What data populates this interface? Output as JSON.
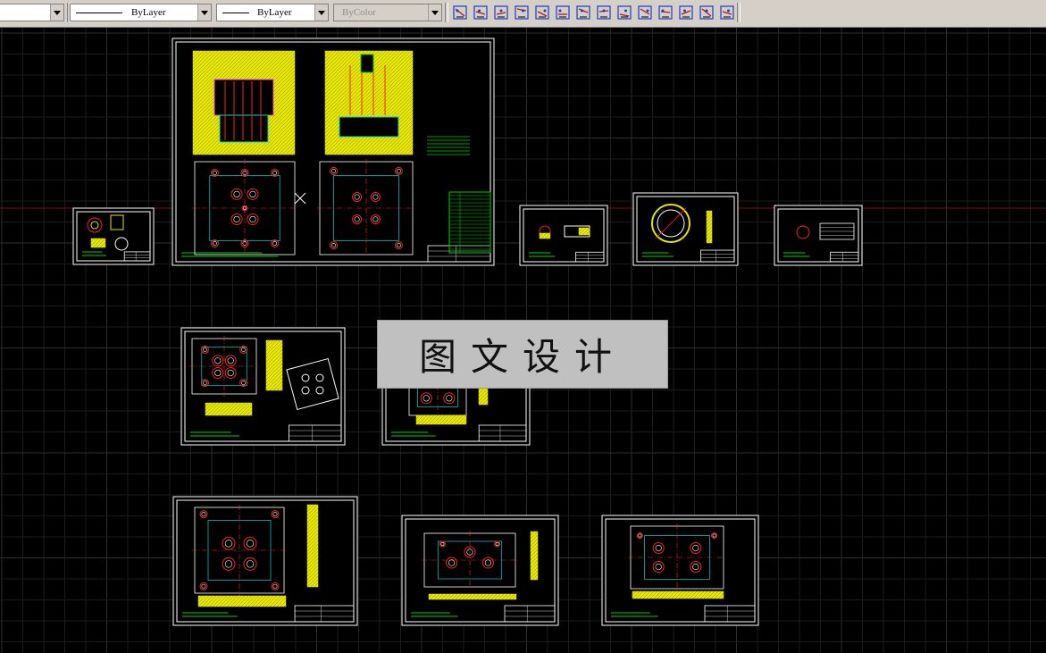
{
  "toolbar": {
    "layer_dropdown_value": "",
    "linetype_dropdown": "ByLayer",
    "lineweight_dropdown": "ByLayer",
    "plotstyle_dropdown": "ByColor",
    "buttons": [
      "text-style-icon",
      "linear-dimension-icon",
      "aligned-dimension-icon",
      "ordinate-dimension-icon",
      "baseline-dimension-icon",
      "continue-dimension-icon",
      "angular-dimension-icon",
      "tolerance-icon",
      "center-mark-icon",
      "leader-icon",
      "dimension-edit-icon",
      "dimension-text-edit-icon",
      "dimension-update-icon",
      "dimension-style-icon"
    ]
  },
  "watermark": {
    "text": "图文设计"
  },
  "colors": {
    "background": "#000000",
    "grid_minor": "#1c1c1c",
    "grid_major": "#2e2e2e",
    "axis": "#7a1010",
    "sheet_border": "#ffffff",
    "drawing_yellow": "#e6e600",
    "drawing_green": "#00d000",
    "drawing_red": "#ff2020",
    "drawing_cyan": "#00d8d8",
    "drawing_magenta": "#ff40ff"
  },
  "sheets": [
    {
      "id": "mold-assembly",
      "content": "assembly"
    },
    {
      "id": "small-left",
      "content": "small"
    },
    {
      "id": "part-a",
      "content": "small"
    },
    {
      "id": "part-b",
      "content": "ring"
    },
    {
      "id": "part-c",
      "content": "small"
    },
    {
      "id": "plate-1",
      "content": "plate"
    },
    {
      "id": "plate-2",
      "content": "plate"
    },
    {
      "id": "plate-3",
      "content": "plate"
    },
    {
      "id": "plate-4",
      "content": "plate"
    },
    {
      "id": "plate-5",
      "content": "plate"
    }
  ]
}
